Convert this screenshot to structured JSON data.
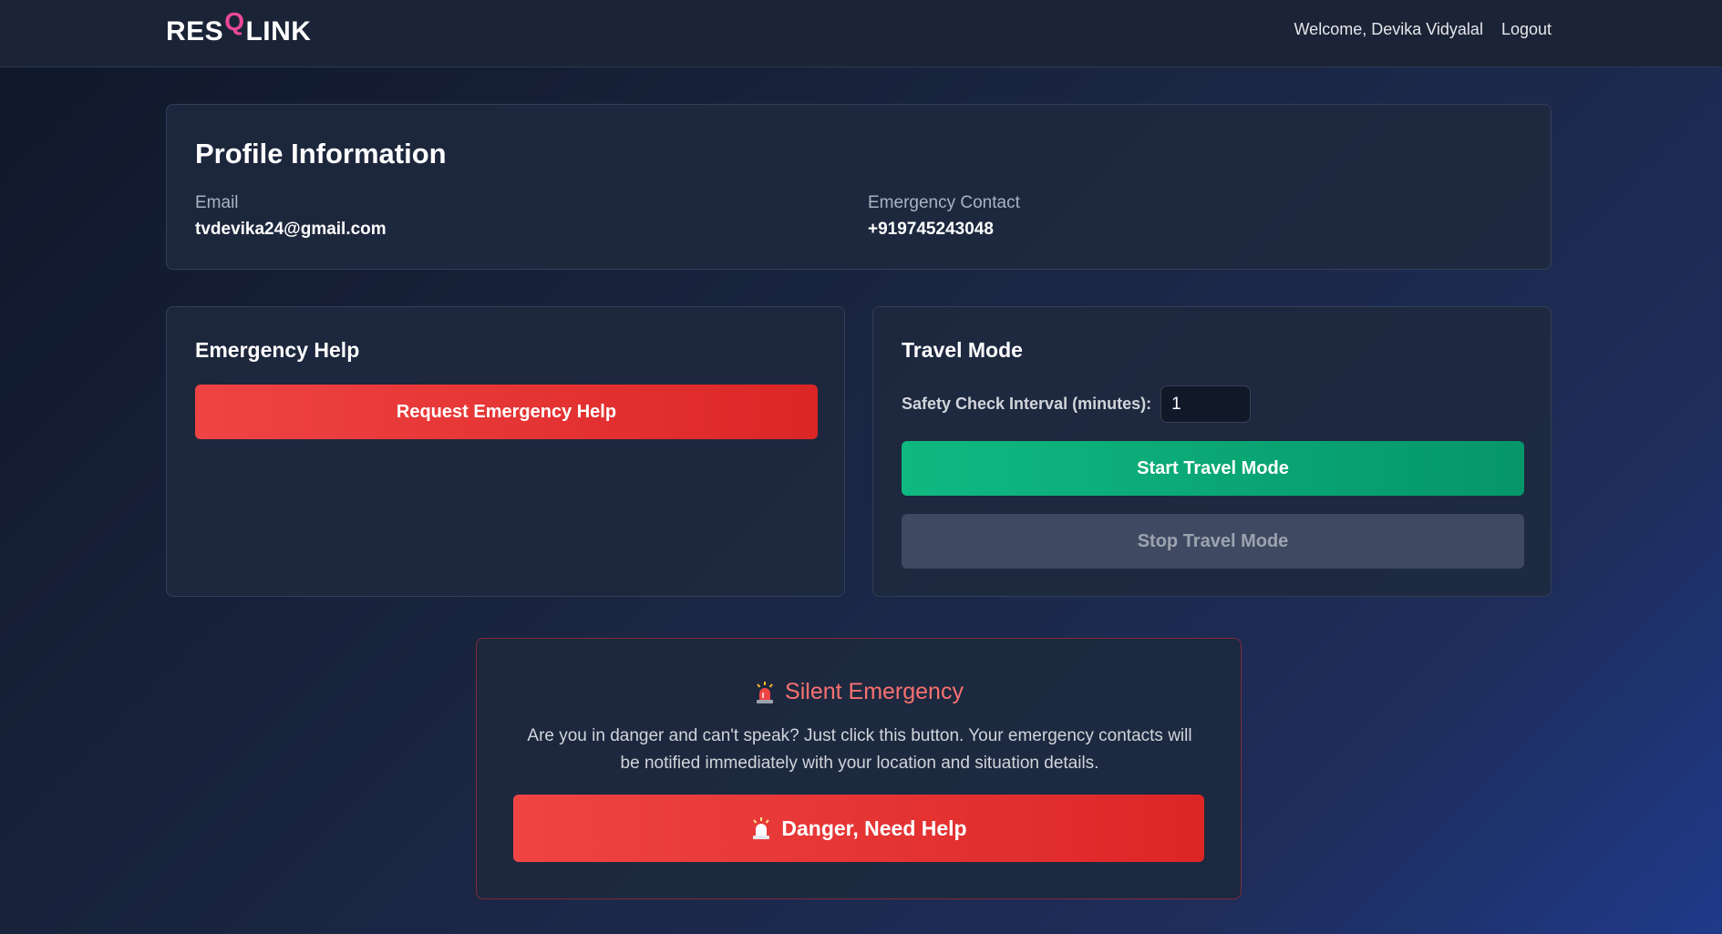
{
  "navbar": {
    "logo_prefix": "RES",
    "logo_q": "Q",
    "logo_suffix": "LINK",
    "welcome": "Welcome, Devika Vidyalal",
    "logout": "Logout"
  },
  "profile": {
    "title": "Profile Information",
    "email_label": "Email",
    "email_value": "tvdevika24@gmail.com",
    "contact_label": "Emergency Contact",
    "contact_value": "+919745243048"
  },
  "emergency_help": {
    "title": "Emergency Help",
    "button": "Request Emergency Help"
  },
  "travel_mode": {
    "title": "Travel Mode",
    "interval_label": "Safety Check Interval (minutes):",
    "interval_value": "1",
    "start_button": "Start Travel Mode",
    "stop_button": "Stop Travel Mode"
  },
  "silent_emergency": {
    "icon": "siren-icon",
    "title": "Silent Emergency",
    "description": "Are you in danger and can't speak? Just click this button. Your emergency contacts will be notified immediately with your location and situation details.",
    "button": "Danger, Need Help"
  },
  "colors": {
    "accent_pink": "#ec4899",
    "danger_red": "#ef4444",
    "success_green": "#10b981",
    "disabled_gray": "#3f4a62"
  }
}
